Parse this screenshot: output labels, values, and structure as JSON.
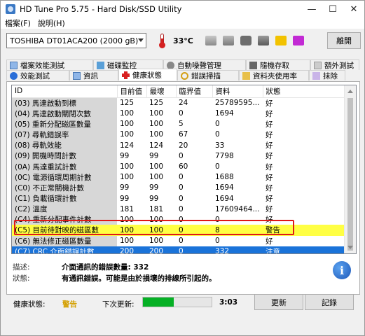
{
  "window": {
    "title": "HD Tune Pro 5.75 - Hard Disk/SSD Utility",
    "minimize": "—",
    "maximize": "☐",
    "close": "✕"
  },
  "menu": {
    "file": "檔案(F)",
    "help": "說明(H)"
  },
  "toolbar": {
    "drive": "TOSHIBA DT01ACA200 (2000 gB)",
    "temperature": "33°C",
    "exit_label": "離開"
  },
  "tabs_row1": [
    {
      "label": "檔案效能測試",
      "icon": "file-benchmark-icon"
    },
    {
      "label": "磁碟監控",
      "icon": "disk-monitor-icon"
    },
    {
      "label": "自動噪聲管理",
      "icon": "aam-icon"
    },
    {
      "label": "隨機存取",
      "icon": "random-access-icon"
    },
    {
      "label": "額外測試",
      "icon": "extra-tests-icon"
    }
  ],
  "tabs_row2": [
    {
      "label": "效能測試",
      "icon": "benchmark-icon"
    },
    {
      "label": "資訊",
      "icon": "info-tab-icon"
    },
    {
      "label": "健康狀態",
      "icon": "health-cross-icon",
      "active": true
    },
    {
      "label": "錯誤掃描",
      "icon": "error-scan-icon"
    },
    {
      "label": "資料夾使用率",
      "icon": "folder-usage-icon"
    },
    {
      "label": "抹除",
      "icon": "erase-icon"
    }
  ],
  "table": {
    "headers": [
      "ID",
      "目前值",
      "最壞",
      "臨界值",
      "資料",
      "狀態"
    ],
    "rows": [
      {
        "id": "(03) 馬達啟動到標",
        "cur": "125",
        "worst": "125",
        "thr": "24",
        "data": "25789595...",
        "status": "好"
      },
      {
        "id": "(04) 馬達啟動關閉次數",
        "cur": "100",
        "worst": "100",
        "thr": "0",
        "data": "1694",
        "status": "好"
      },
      {
        "id": "(05) 重新分配磁區數量",
        "cur": "100",
        "worst": "100",
        "thr": "5",
        "data": "0",
        "status": "好"
      },
      {
        "id": "(07) 尋軌錯誤率",
        "cur": "100",
        "worst": "100",
        "thr": "67",
        "data": "0",
        "status": "好"
      },
      {
        "id": "(08) 尋軌效能",
        "cur": "124",
        "worst": "124",
        "thr": "20",
        "data": "33",
        "status": "好"
      },
      {
        "id": "(09) 開機時間計數",
        "cur": "99",
        "worst": "99",
        "thr": "0",
        "data": "7798",
        "status": "好"
      },
      {
        "id": "(0A) 馬達重試計數",
        "cur": "100",
        "worst": "100",
        "thr": "60",
        "data": "0",
        "status": "好"
      },
      {
        "id": "(0C) 電源循環周期計數",
        "cur": "100",
        "worst": "100",
        "thr": "0",
        "data": "1688",
        "status": "好"
      },
      {
        "id": "(C0) 不正常關機計數",
        "cur": "99",
        "worst": "99",
        "thr": "0",
        "data": "1694",
        "status": "好"
      },
      {
        "id": "(C1) 負載循環計數",
        "cur": "99",
        "worst": "99",
        "thr": "0",
        "data": "1694",
        "status": "好"
      },
      {
        "id": "(C2) 溫度",
        "cur": "181",
        "worst": "181",
        "thr": "0",
        "data": "17609464...",
        "status": "好"
      },
      {
        "id": "(C4) 重新分配事件計數",
        "cur": "100",
        "worst": "100",
        "thr": "0",
        "data": "0",
        "status": "好",
        "clipped": true
      },
      {
        "id": "(C5) 目前待對映的磁區數",
        "cur": "100",
        "worst": "100",
        "thr": "0",
        "data": "8",
        "status": "警告",
        "highlight": "warning"
      },
      {
        "id": "(C6) 無法修正磁區數量",
        "cur": "100",
        "worst": "100",
        "thr": "0",
        "data": "0",
        "status": "好"
      },
      {
        "id": "(C7) CRC 介面錯誤計數",
        "cur": "200",
        "worst": "200",
        "thr": "0",
        "data": "332",
        "status": "注意",
        "highlight": "selected"
      }
    ]
  },
  "description": {
    "label": "描述:",
    "value": "介面通訊的錯誤數量: 332",
    "status_label": "狀態:",
    "status_value": "有通訊錯誤。可能是由於損壞的排線所引起的。"
  },
  "bottom": {
    "health_label": "健康狀態:",
    "health_value": "警告",
    "next_update_label": "下次更新:",
    "progress_fraction": 0.45,
    "countdown": "3:03",
    "update_label": "更新",
    "log_label": "記錄"
  },
  "colors": {
    "warning_row": "#ffff44",
    "selected_row": "#1a73d9",
    "highlight_box": "#e01818",
    "progress": "#06b025"
  }
}
